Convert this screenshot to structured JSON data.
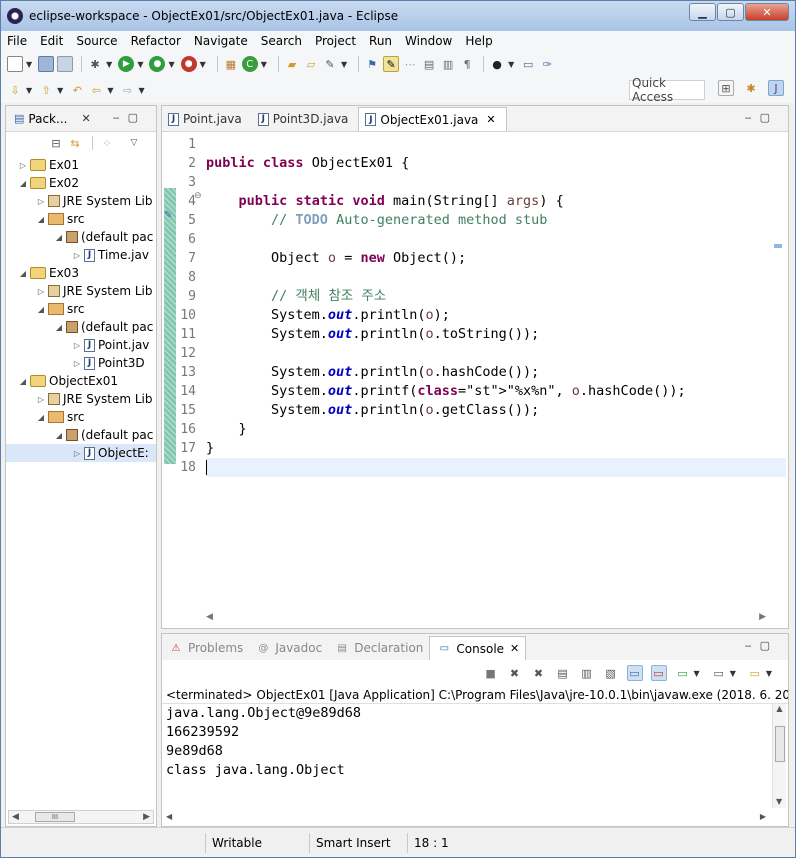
{
  "window": {
    "title": "eclipse-workspace - ObjectEx01/src/ObjectEx01.java - Eclipse"
  },
  "menu": [
    "File",
    "Edit",
    "Source",
    "Refactor",
    "Navigate",
    "Search",
    "Project",
    "Run",
    "Window",
    "Help"
  ],
  "toolbar": {
    "quick_access": "Quick Access"
  },
  "explorer": {
    "title": "Pack...",
    "tree": [
      {
        "label": "Ex01",
        "icon": "project-icon",
        "toggle": "▷"
      },
      {
        "label": "Ex02",
        "icon": "project-icon",
        "toggle": "◢"
      },
      {
        "label": "JRE System Lib",
        "icon": "library-icon",
        "toggle": "▷"
      },
      {
        "label": "src",
        "icon": "source-folder-icon",
        "toggle": "◢"
      },
      {
        "label": "(default pac",
        "icon": "package-icon",
        "toggle": "◢"
      },
      {
        "label": "Time.jav",
        "icon": "java-file-icon",
        "toggle": "▷"
      },
      {
        "label": "Ex03",
        "icon": "project-icon",
        "toggle": "◢"
      },
      {
        "label": "JRE System Lib",
        "icon": "library-icon",
        "toggle": "▷"
      },
      {
        "label": "src",
        "icon": "source-folder-icon",
        "toggle": "◢"
      },
      {
        "label": "(default pac",
        "icon": "package-icon",
        "toggle": "◢"
      },
      {
        "label": "Point.jav",
        "icon": "java-file-icon",
        "toggle": "▷"
      },
      {
        "label": "Point3D",
        "icon": "java-file-icon",
        "toggle": "▷"
      },
      {
        "label": "ObjectEx01",
        "icon": "project-icon",
        "toggle": "◢"
      },
      {
        "label": "JRE System Lib",
        "icon": "library-icon",
        "toggle": "▷"
      },
      {
        "label": "src",
        "icon": "source-folder-icon",
        "toggle": "◢"
      },
      {
        "label": "(default pac",
        "icon": "package-icon",
        "toggle": "◢"
      },
      {
        "label": "ObjectE:",
        "icon": "java-file-icon",
        "toggle": "▷"
      }
    ],
    "hscroll_thumb": "III"
  },
  "editor": {
    "tabs": [
      {
        "label": "Point.java"
      },
      {
        "label": "Point3D.java"
      },
      {
        "label": "ObjectEx01.java"
      }
    ],
    "line_numbers": [
      "1",
      "2",
      "3",
      "4",
      "5",
      "6",
      "7",
      "8",
      "9",
      "10",
      "11",
      "12",
      "13",
      "14",
      "15",
      "16",
      "17",
      "18"
    ],
    "code": [
      "",
      "public class ObjectEx01 {",
      "",
      "    public static void main(String[] args) {",
      "        // TODO Auto-generated method stub",
      "",
      "        Object o = new Object();",
      "",
      "        // 객체 참조 주소",
      "        System.out.println(o);",
      "        System.out.println(o.toString());",
      "",
      "        System.out.println(o.hashCode());",
      "        System.out.printf(\"%x%n\", o.hashCode());",
      "        System.out.println(o.getClass());",
      "    }",
      "}",
      ""
    ]
  },
  "console": {
    "tabs": [
      {
        "label": "Problems"
      },
      {
        "label": "Javadoc"
      },
      {
        "label": "Declaration"
      },
      {
        "label": "Console"
      }
    ],
    "status": "<terminated> ObjectEx01 [Java Application] C:\\Program Files\\Java\\jre-10.0.1\\bin\\javaw.exe (2018. 6. 20. 오후 1",
    "output": [
      "java.lang.Object@9e89d68",
      "166239592",
      "9e89d68",
      "class java.lang.Object"
    ]
  },
  "statusbar": {
    "mode": "Writable",
    "insert": "Smart Insert",
    "position": "18 : 1"
  }
}
